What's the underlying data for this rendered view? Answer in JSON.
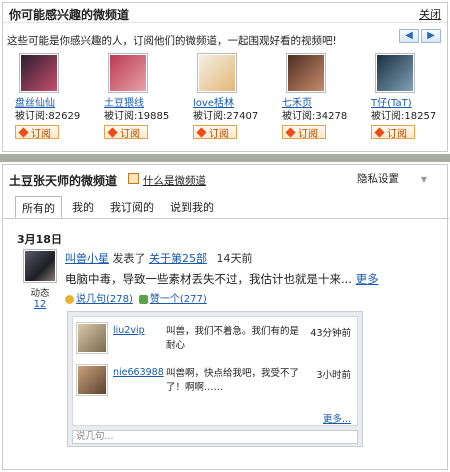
{
  "recommend": {
    "title": "你可能感兴趣的微频道",
    "close": "关闭",
    "description": "这些可能是你感兴趣的人，订阅他们的微频道，一起围观好看的视频吧!",
    "pager_prev": "◀",
    "pager_next": "▶",
    "users": [
      {
        "name": "盘丝仙仙",
        "subs": "被订阅:82629",
        "btn": "订阅",
        "color_a": "#2b1f2e",
        "color_b": "#c94d6f"
      },
      {
        "name": "土豆猥线",
        "subs": "被订阅:19885",
        "btn": "订阅",
        "color_a": "#b83a55",
        "color_b": "#e9a0aa"
      },
      {
        "name": "love栝林",
        "subs": "被订阅:27407",
        "btn": "订阅",
        "color_a": "#f4efe2",
        "color_b": "#e5b77a"
      },
      {
        "name": "七禾页",
        "subs": "被订阅:34278",
        "btn": "订阅",
        "color_a": "#4d2f22",
        "color_b": "#c98a6b"
      },
      {
        "name": "T仔(TaT)",
        "subs": "被订阅:18257",
        "btn": "订阅",
        "color_a": "#1c2e3f",
        "color_b": "#7fa1b8"
      }
    ]
  },
  "channel": {
    "title": "土豆张天师的微频道",
    "what": "什么是微频道",
    "privacy": "隐私设置",
    "arrows": "▲ ▼",
    "tabs": [
      "所有的",
      "我的",
      "我订阅的",
      "说到我的"
    ],
    "date": "3月18日",
    "poster": {
      "label": "动态",
      "count": "12"
    },
    "post": {
      "author": "叫兽小星",
      "verb": "发表了",
      "target": "关于第25部",
      "time": "14天前",
      "text": "电脑中毒，导致一些素材丢失不过，我估计也就是十来...",
      "more": "更多",
      "comment_action": "说几句(278)",
      "like_action": "赞一个(277)"
    },
    "comments": [
      {
        "name": "liu2vip",
        "text": "叫兽，我们不着急。我们有的是耐心",
        "time": "43分钟前",
        "color_a": "#d9c9a8",
        "color_b": "#7a6a4e"
      },
      {
        "name": "nie663988",
        "text": "叫兽啊，快点给我吧，我受不了了！啊啊……",
        "time": "3小时前",
        "color_a": "#caa27a",
        "color_b": "#5d4330"
      }
    ],
    "more": "更多...",
    "input_placeholder": "说几句..."
  }
}
